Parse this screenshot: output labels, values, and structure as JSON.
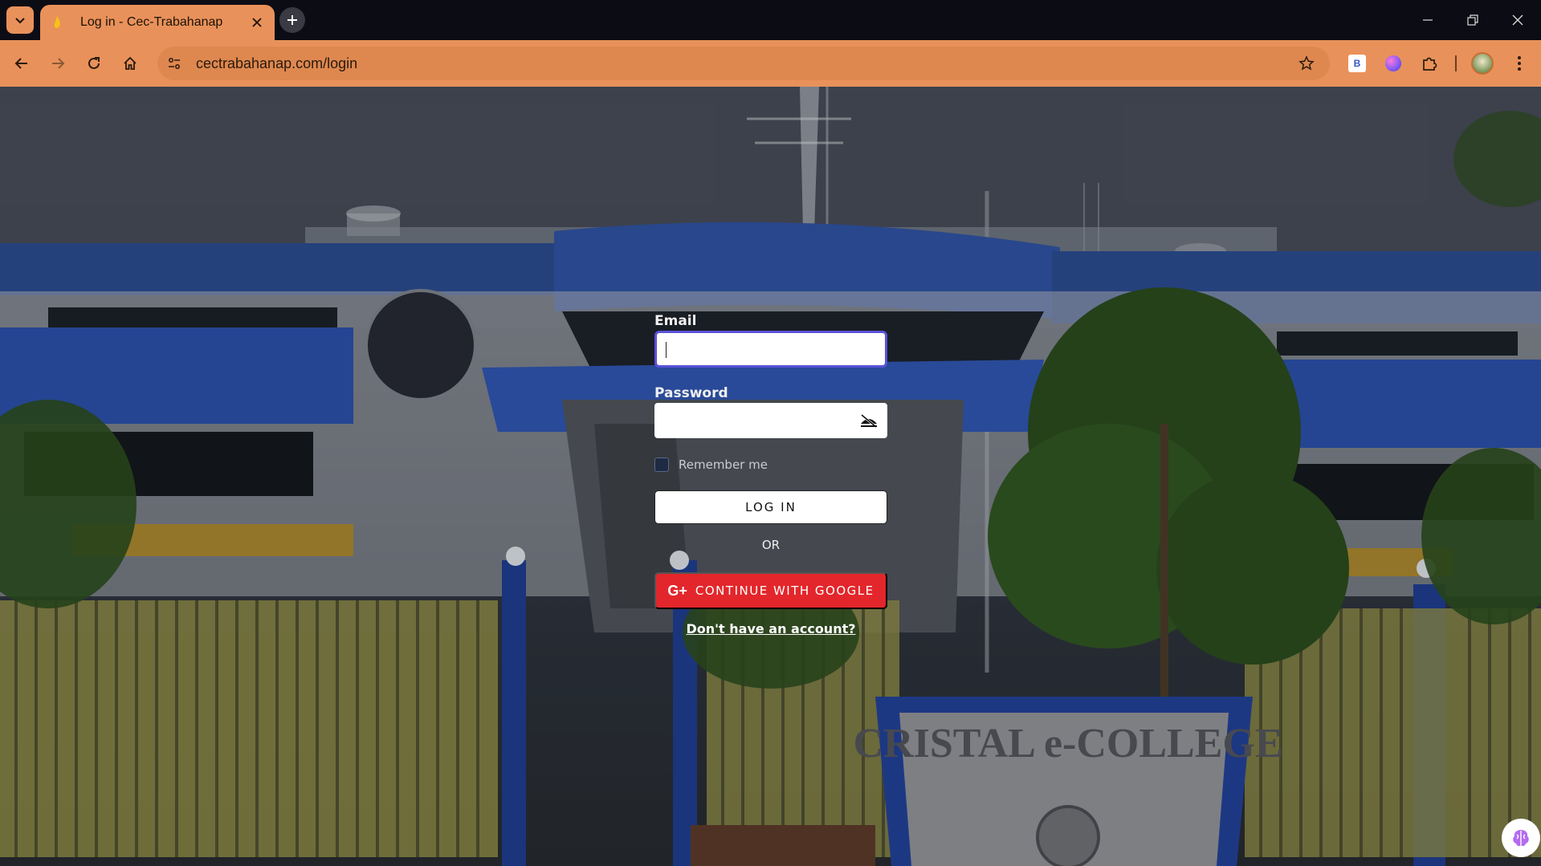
{
  "browser": {
    "tab_title": "Log in - Cec-Trabahanap",
    "url": "cectrabahanap.com/login",
    "accent": "#e9915a",
    "extension_b_label": "B"
  },
  "form": {
    "email_label": "Email",
    "email_value": "",
    "password_label": "Password",
    "password_value": "",
    "remember_label": "Remember me",
    "remember_checked": false,
    "login_label": "LOG IN",
    "or_label": "OR",
    "google_icon_text": "G+",
    "google_label": "CONTINUE WITH GOOGLE",
    "signup_link": "Don't have an account?",
    "primary_color": "#e3262b",
    "focus_color": "#5a52d8"
  },
  "background": {
    "sign_text": "CRISTAL e-COLLEGE"
  }
}
